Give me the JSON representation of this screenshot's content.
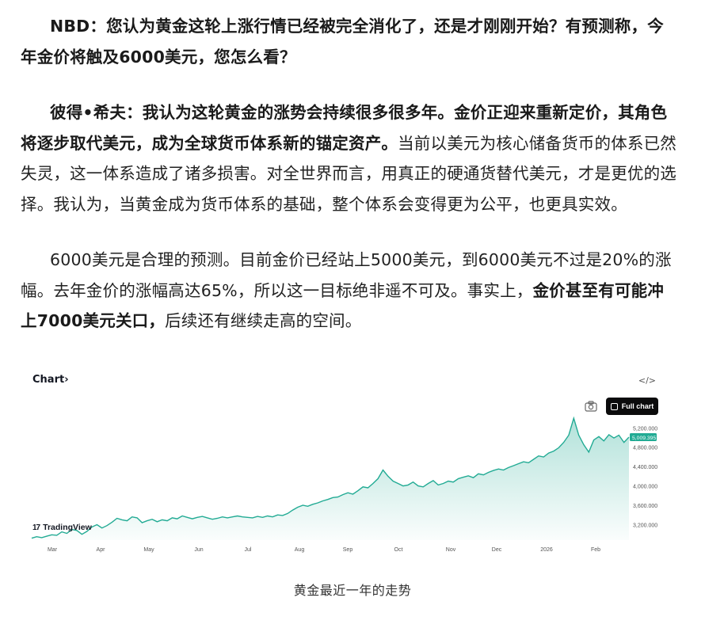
{
  "article": {
    "p1": {
      "bold": "NBD：您认为黄金这轮上涨行情已经被完全消化了，还是才刚刚开始？有预测称，今年金价将触及6000美元，您怎么看？"
    },
    "p2": {
      "bold": "彼得•希夫：我认为这轮黄金的涨势会持续很多很多年。金价正迎来重新定价，其角色将逐步取代美元，成为全球货币体系新的锚定资产。",
      "text": "当前以美元为核心储备货币的体系已然失灵，这一体系造成了诸多损害。对全世界而言，用真正的硬通货替代美元，才是更优的选择。我认为，当黄金成为货币体系的基础，整个体系会变得更为公平，也更具实效。"
    },
    "p3": {
      "text1": "6000美元是合理的预测。目前金价已经站上5000美元，到6000美元不过是20%的涨幅。去年金价的涨幅高达65%，所以这一目标绝非遥不可及。事实上，",
      "bold": "金价甚至有可能冲上7000美元关口，",
      "text2": "后续还有继续走高的空间。"
    }
  },
  "chart_widget": {
    "title": "Chart›",
    "embed_icon": "</>",
    "full_chart_label": "Full chart",
    "brand": "TradingView",
    "brand_mark": "17",
    "camera_icon": "camera-icon"
  },
  "chart_data": {
    "type": "area",
    "x_ticks": [
      "Mar",
      "Apr",
      "May",
      "Jun",
      "Jul",
      "Aug",
      "Sep",
      "Oct",
      "Nov",
      "Dec",
      "2026",
      "Feb"
    ],
    "y_ticks": [
      "5,200.000",
      "4,800.000",
      "4,400.000",
      "4,000.000",
      "3,600.000",
      "3,200.000"
    ],
    "y_tick_values": [
      5200,
      4800,
      4400,
      4000,
      3600,
      3200
    ],
    "ylim": [
      2880,
      5500
    ],
    "last_value_label": "5,009.395",
    "last_value": 5009.395,
    "values": [
      2920,
      2950,
      2930,
      2960,
      2990,
      2980,
      3050,
      3020,
      3100,
      3080,
      3000,
      3060,
      3150,
      3200,
      3130,
      3180,
      3250,
      3330,
      3300,
      3280,
      3360,
      3340,
      3240,
      3280,
      3310,
      3260,
      3300,
      3280,
      3340,
      3320,
      3380,
      3350,
      3320,
      3350,
      3370,
      3340,
      3310,
      3330,
      3360,
      3340,
      3360,
      3380,
      3360,
      3350,
      3340,
      3370,
      3350,
      3380,
      3360,
      3400,
      3390,
      3430,
      3500,
      3560,
      3600,
      3580,
      3620,
      3650,
      3690,
      3720,
      3760,
      3770,
      3820,
      3860,
      3830,
      3900,
      3980,
      3960,
      4050,
      4150,
      4330,
      4200,
      4100,
      4050,
      4000,
      4020,
      4080,
      4000,
      3980,
      4050,
      4110,
      4020,
      4050,
      4100,
      4080,
      4150,
      4180,
      4210,
      4170,
      4250,
      4230,
      4280,
      4320,
      4350,
      4330,
      4380,
      4420,
      4460,
      4500,
      4480,
      4550,
      4620,
      4600,
      4680,
      4720,
      4790,
      4900,
      5050,
      5400,
      5050,
      4850,
      4700,
      4950,
      5020,
      4930,
      5060,
      4990,
      5050,
      4900,
      5009
    ]
  },
  "caption": "黄金最近一年的走势"
}
